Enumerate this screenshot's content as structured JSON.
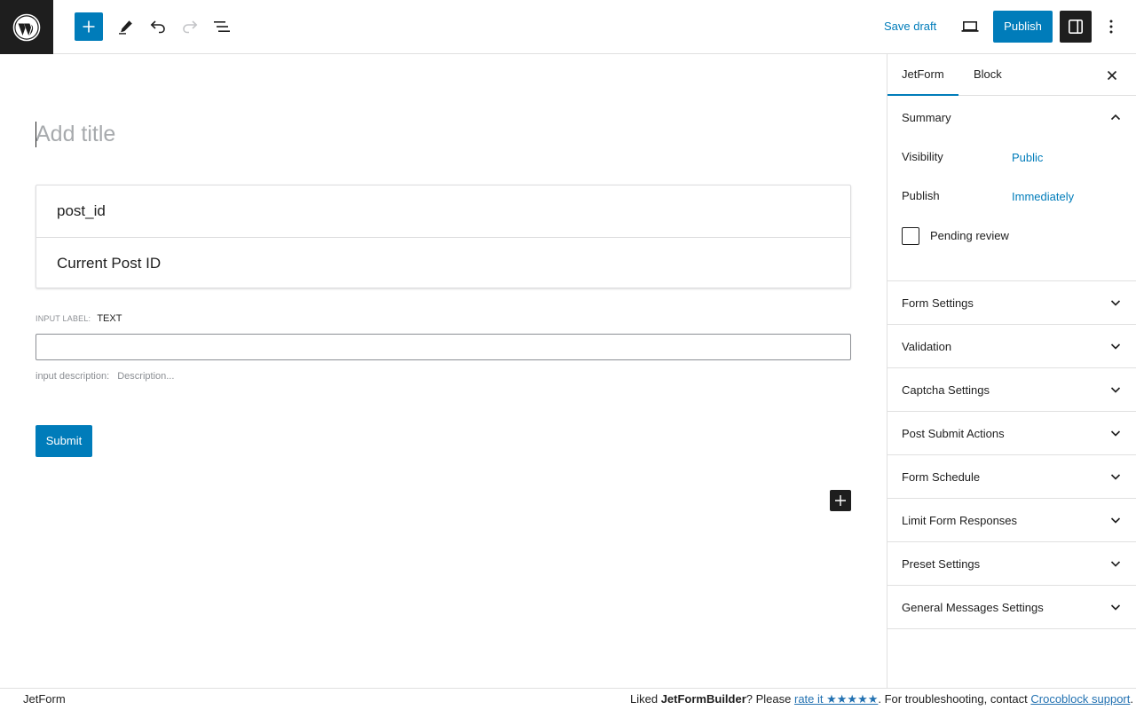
{
  "toolbar": {
    "save_draft": "Save draft",
    "publish": "Publish"
  },
  "editor": {
    "title_placeholder": "Add title",
    "hidden_field": {
      "name": "post_id",
      "value": "Current Post ID"
    },
    "text_field": {
      "label_caption": "INPUT LABEL:",
      "label_value": "TEXT",
      "description_caption": "input description:",
      "description_placeholder": "Description..."
    },
    "submit_label": "Submit"
  },
  "sidebar": {
    "tabs": [
      {
        "label": "JetForm",
        "active": true
      },
      {
        "label": "Block",
        "active": false
      }
    ],
    "summary": {
      "title": "Summary",
      "visibility_label": "Visibility",
      "visibility_value": "Public",
      "publish_label": "Publish",
      "publish_value": "Immediately",
      "pending_review": "Pending review",
      "pending_review_checked": false
    },
    "panels": [
      "Form Settings",
      "Validation",
      "Captcha Settings",
      "Post Submit Actions",
      "Form Schedule",
      "Limit Form Responses",
      "Preset Settings",
      "General Messages Settings"
    ]
  },
  "footer": {
    "left": "JetForm",
    "liked": "Liked ",
    "product": "JetFormBuilder",
    "please": "? Please ",
    "rate_link": "rate it ★★★★★",
    "troubleshoot": ". For troubleshooting, contact ",
    "support_link": "Crocoblock support",
    "end": "."
  },
  "colors": {
    "accent": "#007cba",
    "dark": "#1e1e1e",
    "border": "#e0e0e0"
  },
  "icons": [
    "wordpress-logo-icon",
    "plus-icon",
    "pencil-icon",
    "undo-icon",
    "redo-icon",
    "list-view-icon",
    "desktop-preview-icon",
    "sidebar-settings-icon",
    "more-vertical-icon",
    "close-icon",
    "chevron-up-icon",
    "chevron-down-icon"
  ]
}
